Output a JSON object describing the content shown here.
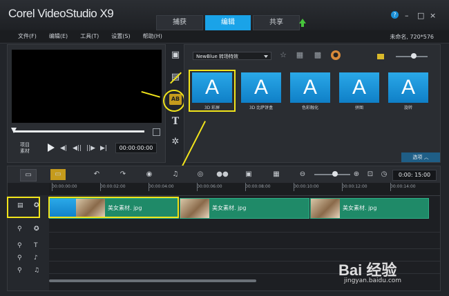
{
  "app": {
    "title": "Corel VideoStudio X9",
    "window_controls": [
      "?",
      "–",
      "□",
      "×"
    ]
  },
  "tabs": [
    {
      "label": "捕获",
      "active": false
    },
    {
      "label": "编辑",
      "active": true
    },
    {
      "label": "共享",
      "active": false
    }
  ],
  "menu": {
    "items": [
      "文件(F)",
      "编辑(E)",
      "工具(T)",
      "设置(S)",
      "帮助(H)"
    ],
    "project_info": "未命名, 720*576"
  },
  "preview": {
    "project_label": "项目",
    "clip_label": "素材",
    "timecode": "00:00:00:00",
    "controls": [
      "◀|",
      "◀||",
      "||▶",
      "▶|"
    ]
  },
  "library": {
    "dropdown_value": "NewBlue 转场特效",
    "options_button": "选项  ︿",
    "thumbnails": [
      {
        "caption": "3D 彩屏",
        "glyph": "A",
        "selected": true
      },
      {
        "caption": "3D 比萨饼盒",
        "glyph": "A",
        "selected": false
      },
      {
        "caption": "色彩融化",
        "glyph": "A",
        "selected": false
      },
      {
        "caption": "拼图",
        "glyph": "A",
        "selected": false
      },
      {
        "caption": "旋转",
        "glyph": "A",
        "selected": false
      }
    ]
  },
  "timeline": {
    "timecode": "0:00: 15:00",
    "ruler": [
      "00:00:00:00",
      "00:00:02:00",
      "00:00:04:00",
      "00:00:06:00",
      "00:00:08:00",
      "00:00:10:00",
      "00:00:12:00",
      "00:00:14:00"
    ],
    "clips": [
      {
        "label": "美女素材. jpg"
      },
      {
        "label": "美女素材. jpg"
      },
      {
        "label": "美女素材. jpg"
      }
    ]
  },
  "watermark": {
    "brand": "Bai 经验",
    "url": "jingyan.baidu.com"
  },
  "colors": {
    "accent": "#1aa3e8",
    "highlight": "#f2e51b",
    "clip": "#1f8a68"
  }
}
